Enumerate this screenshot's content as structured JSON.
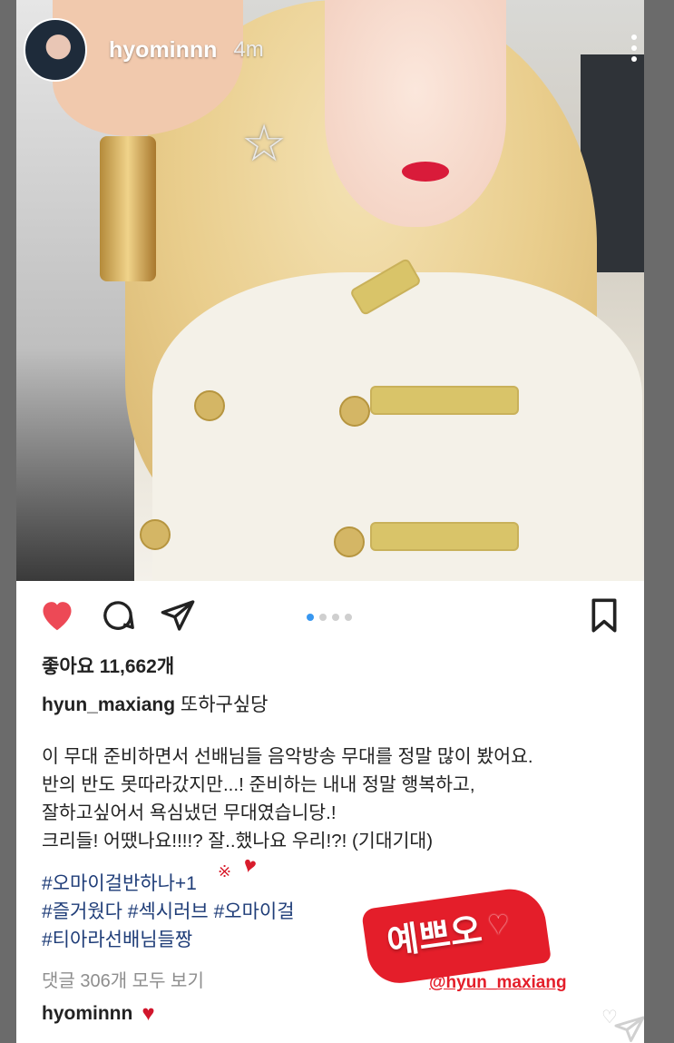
{
  "story": {
    "username": "hyominnn",
    "time_ago": "4m"
  },
  "post": {
    "carousel_dots": 4,
    "carousel_active_index": 0,
    "likes_text": "좋아요 11,662개",
    "caption_username": "hyun_maxiang",
    "caption_text": "또하구싶당",
    "body_lines": [
      "이 무대 준비하면서 선배님들 음악방송 무대를 정말 많이 봤어요.",
      "반의 반도 못따라갔지만...! 준비하는 내내 정말 행복하고,",
      "잘하고싶어서 욕심냈던 무대였습니당.!",
      "크리들! 어땠나요!!!!? 잘..했나요 우리!?! (기대기대)"
    ],
    "hashtag_lines": [
      "#오마이걸반하나+1",
      "#즐거웠다 #섹시러브 #오마이걸",
      "#티아라선배님들짱"
    ],
    "view_comments": "댓글 306개 모두 보기",
    "comment_user": "hyominnn",
    "comment_heart": "♥"
  },
  "stickers": {
    "text": "예쁘오",
    "heart": "♥",
    "mention": "@hyun_maxiang",
    "small_heart": "♥",
    "sparkle": "※"
  },
  "colors": {
    "like_red": "#ed4956",
    "hashtag_blue": "#1f3d78",
    "sticker_red": "#e41e2a",
    "active_dot": "#3897f0"
  }
}
